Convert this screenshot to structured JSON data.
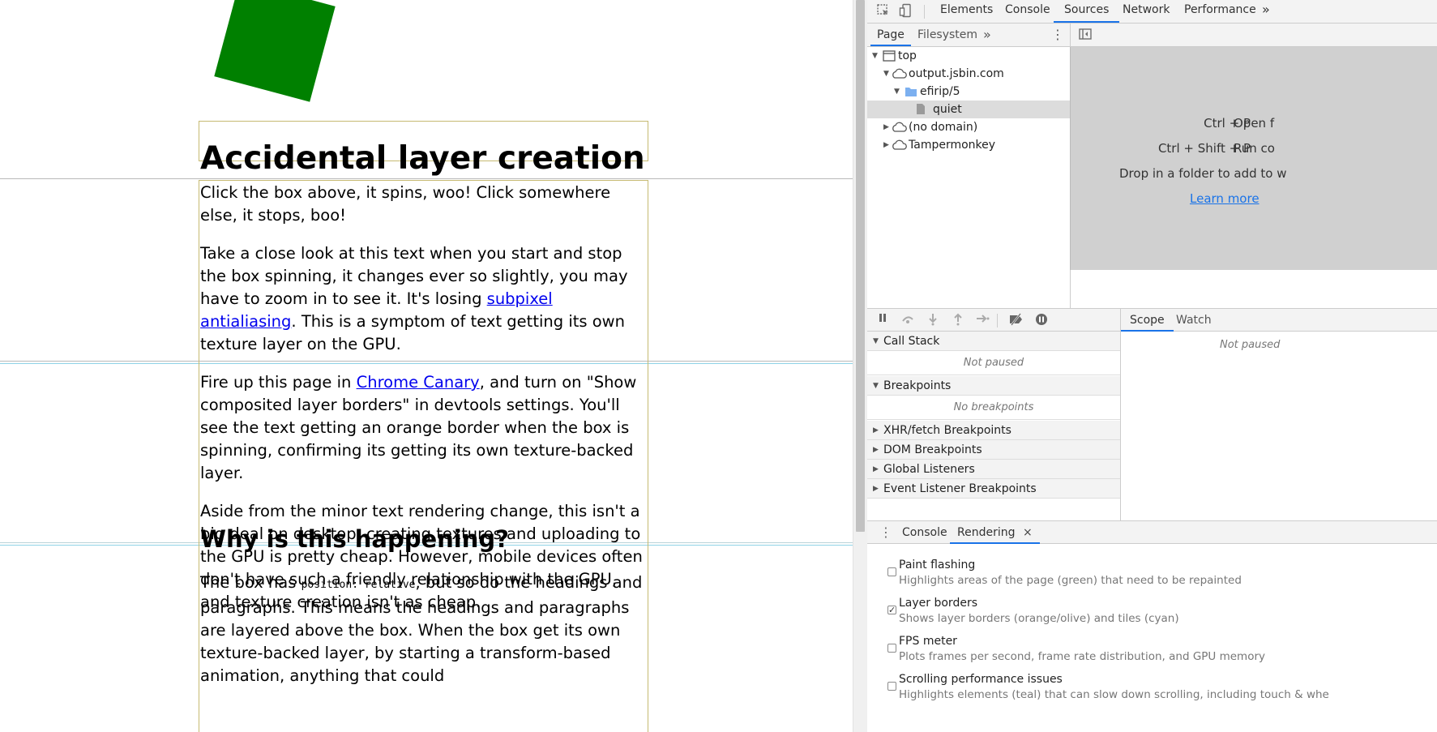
{
  "page": {
    "heading": "Accidental layer creation",
    "paragraphs": [
      {
        "parts": [
          "Click the box above, it spins, woo! Click somewhere else, it stops, boo!"
        ]
      },
      {
        "before": "Take a close look at this text when you start and stop the box spinning, it changes ever so slightly, you may have to zoom in to see it. It's losing ",
        "link": "subpixel antialiasing",
        "after": ". This is a symptom of text getting its own texture layer on the GPU."
      },
      {
        "before": "Fire up this page in ",
        "link": "Chrome Canary",
        "after": ", and turn on \"Show composited layer borders\" in devtools settings. You'll see the text getting an orange border when the box is spinning, confirming its getting its own texture-backed layer."
      },
      {
        "parts": [
          "Aside from the minor text rendering change, this isn't a big deal on desktop, creating textures and uploading to the GPU is pretty cheap. However, mobile devices often don't have such a friendly relationship with the GPU, and texture creation isn't as cheap."
        ]
      }
    ],
    "subheading": "Why is this happening?",
    "last_paragraph": {
      "before": "The box has ",
      "code": "position: relative",
      "after": ", but so do the headings and paragraphs. This means the headings and paragraphs are layered above the box. When the box get its own texture-backed layer, by starting a transform-based animation, anything that could"
    },
    "colors": {
      "box": "#008000",
      "layer_border": "#c6ba72",
      "tile_border": "#8fd3e6",
      "link": "#0000ee"
    }
  },
  "devtools": {
    "icons": {
      "inspect": "inspect-element-icon",
      "device": "device-toolbar-icon"
    },
    "tabs": [
      "Elements",
      "Console",
      "Sources",
      "Network",
      "Performance"
    ],
    "active_tab": "Sources",
    "more_tabs": "»",
    "navigator": {
      "tabs": [
        "Page",
        "Filesystem"
      ],
      "more": "»",
      "menu": "⋮",
      "tree": [
        {
          "label": "top",
          "icon": "frame-icon",
          "depth": 0,
          "expanded": true
        },
        {
          "label": "output.jsbin.com",
          "icon": "cloud-icon",
          "depth": 1,
          "expanded": true
        },
        {
          "label": "efirip/5",
          "icon": "folder-icon",
          "depth": 2,
          "expanded": true
        },
        {
          "label": "quiet",
          "icon": "file-icon",
          "depth": 3,
          "selected": true
        },
        {
          "label": "(no domain)",
          "icon": "cloud-icon",
          "depth": 1,
          "expanded": false
        },
        {
          "label": "Tampermonkey",
          "icon": "cloud-icon",
          "depth": 1,
          "expanded": false
        }
      ]
    },
    "editor": {
      "shortcuts": [
        {
          "keys": "Ctrl + P",
          "action": "Open f"
        },
        {
          "keys": "Ctrl + Shift + P",
          "action": "Run co"
        }
      ],
      "drop_text": "Drop in a folder to add to w",
      "learn_more": "Learn more"
    },
    "debugger": {
      "sections": [
        {
          "title": "Call Stack",
          "expanded": true,
          "body": "Not paused"
        },
        {
          "title": "Breakpoints",
          "expanded": true,
          "body": "No breakpoints"
        },
        {
          "title": "XHR/fetch Breakpoints",
          "expanded": false
        },
        {
          "title": "DOM Breakpoints",
          "expanded": false
        },
        {
          "title": "Global Listeners",
          "expanded": false
        },
        {
          "title": "Event Listener Breakpoints",
          "expanded": false
        }
      ],
      "scope_tabs": [
        "Scope",
        "Watch"
      ],
      "scope_status": "Not paused"
    },
    "drawer": {
      "menu": "⋮",
      "tabs": [
        "Console",
        "Rendering"
      ],
      "active_tab": "Rendering",
      "close": "×",
      "options": [
        {
          "title": "Paint flashing",
          "desc": "Highlights areas of the page (green) that need to be repainted",
          "checked": false
        },
        {
          "title": "Layer borders",
          "desc": "Shows layer borders (orange/olive) and tiles (cyan)",
          "checked": true
        },
        {
          "title": "FPS meter",
          "desc": "Plots frames per second, frame rate distribution, and GPU memory",
          "checked": false
        },
        {
          "title": "Scrolling performance issues",
          "desc": "Highlights elements (teal) that can slow down scrolling, including touch & whe",
          "checked": false
        }
      ]
    }
  }
}
